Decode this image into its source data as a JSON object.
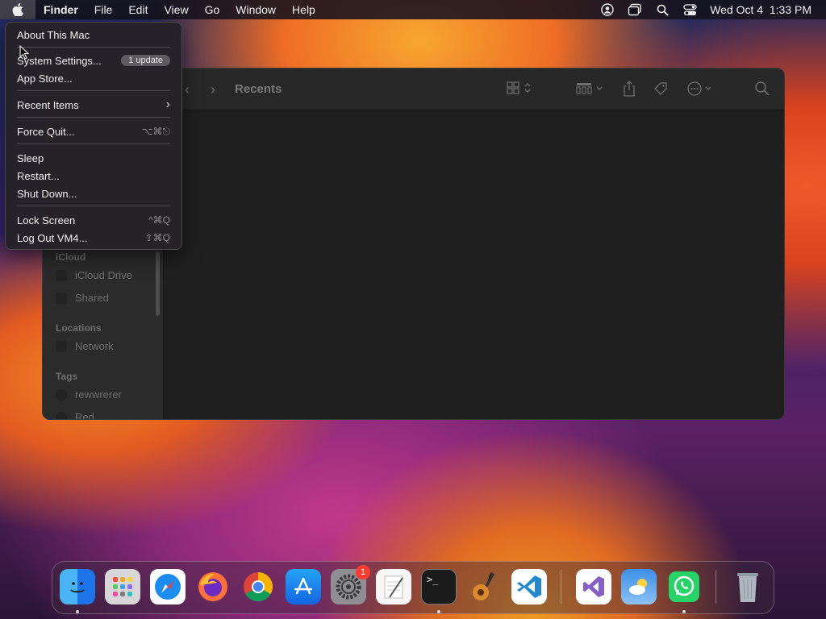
{
  "menubar": {
    "apple_icon": "apple-icon",
    "app_name": "Finder",
    "menus": [
      "File",
      "Edit",
      "View",
      "Go",
      "Window",
      "Help"
    ],
    "status_icons": [
      "user-icon",
      "windows-icon",
      "search-icon",
      "control-center-icon"
    ],
    "clock": "Wed Oct 4  1:33 PM"
  },
  "apple_menu": {
    "about": "About This Mac",
    "system_settings": "System Settings...",
    "update_badge": "1 update",
    "app_store": "App Store...",
    "recent_items": "Recent Items",
    "force_quit": "Force Quit...",
    "force_quit_shortcut": "⌥⌘⎋",
    "sleep": "Sleep",
    "restart": "Restart...",
    "shut_down": "Shut Down...",
    "lock_screen": "Lock Screen",
    "lock_screen_shortcut": "^⌘Q",
    "log_out": "Log Out VM4...",
    "log_out_shortcut": "⇧⌘Q"
  },
  "finder": {
    "title": "Recents",
    "sidebar": {
      "icloud_header": "iCloud",
      "icloud_drive": "iCloud Drive",
      "shared": "Shared",
      "locations_header": "Locations",
      "network": "Network",
      "tags_header": "Tags",
      "tag1": "rewwrerer",
      "tag2": "Red"
    }
  },
  "dock": {
    "apps": [
      "Finder",
      "Launchpad",
      "Safari",
      "Firefox",
      "Chrome",
      "App Store",
      "System Settings",
      "TextEdit",
      "Terminal",
      "GarageBand",
      "VS Code",
      "Visual Studio",
      "Weather",
      "WhatsApp",
      "Trash"
    ],
    "settings_badge": "1"
  },
  "colors": {
    "menubar_bg": "#16121c",
    "menu_bg": "#262228",
    "finder_bg": "#1f1f1f",
    "badge_red": "#ff3b30"
  }
}
